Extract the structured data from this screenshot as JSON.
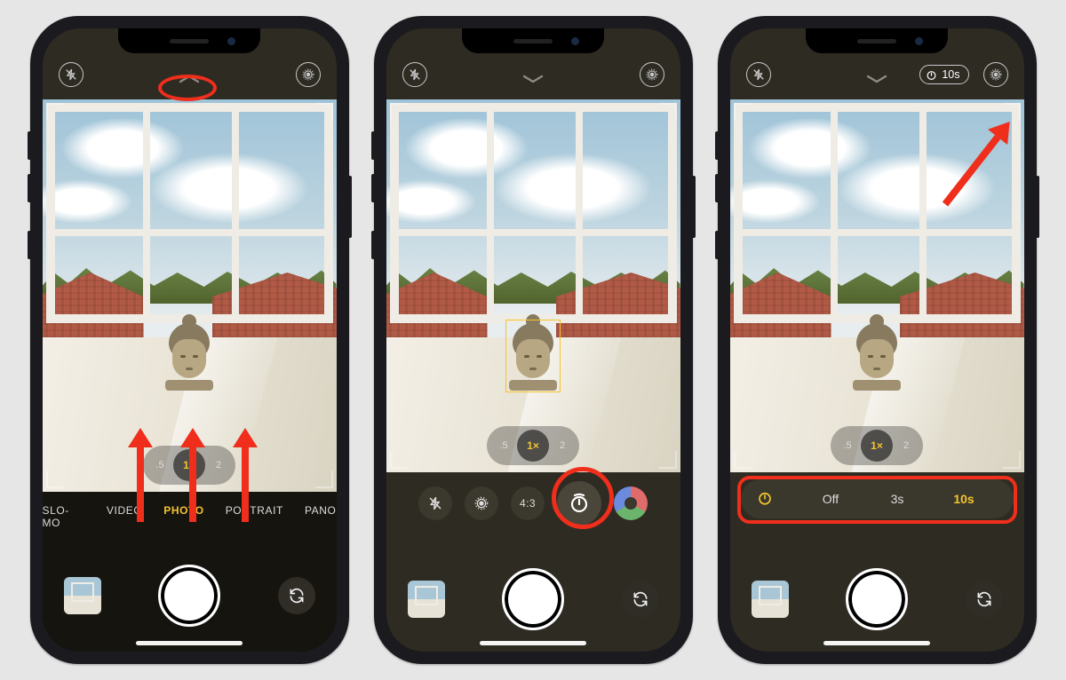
{
  "top": {
    "flash_state": "off",
    "live_state": "off",
    "timer_badge": "10s"
  },
  "zoom": {
    "wide": ".5",
    "normal": "1×",
    "tele": "2",
    "normal_short": "1"
  },
  "modes": {
    "slomo": "SLO-MO",
    "video": "VIDEO",
    "photo": "PHOTO",
    "portrait": "PORTRAIT",
    "pano": "PANO"
  },
  "drawer": {
    "ratio": "4:3"
  },
  "timer": {
    "off": "Off",
    "t3": "3s",
    "t10": "10s",
    "selected": "10s"
  }
}
